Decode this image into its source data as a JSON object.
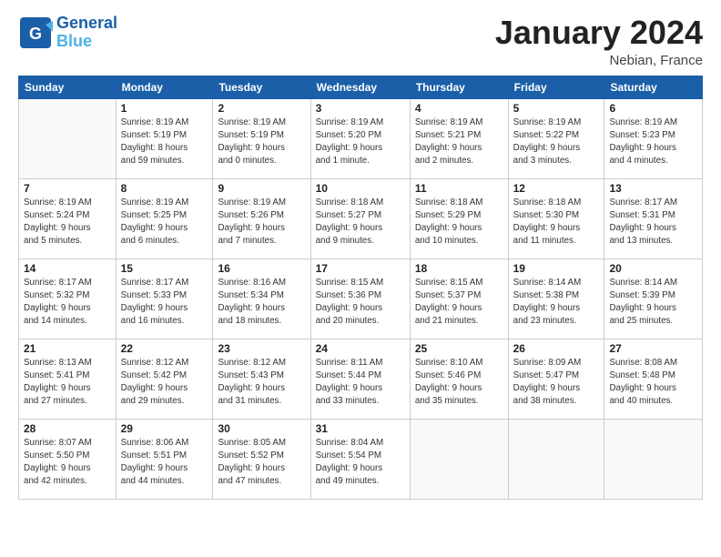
{
  "header": {
    "logo_line1": "General",
    "logo_line2": "Blue",
    "month_title": "January 2024",
    "location": "Nebian, France"
  },
  "weekdays": [
    "Sunday",
    "Monday",
    "Tuesday",
    "Wednesday",
    "Thursday",
    "Friday",
    "Saturday"
  ],
  "weeks": [
    [
      {
        "day": "",
        "sunrise": "",
        "sunset": "",
        "daylight": ""
      },
      {
        "day": "1",
        "sunrise": "Sunrise: 8:19 AM",
        "sunset": "Sunset: 5:19 PM",
        "daylight": "Daylight: 8 hours and 59 minutes."
      },
      {
        "day": "2",
        "sunrise": "Sunrise: 8:19 AM",
        "sunset": "Sunset: 5:19 PM",
        "daylight": "Daylight: 9 hours and 0 minutes."
      },
      {
        "day": "3",
        "sunrise": "Sunrise: 8:19 AM",
        "sunset": "Sunset: 5:20 PM",
        "daylight": "Daylight: 9 hours and 1 minute."
      },
      {
        "day": "4",
        "sunrise": "Sunrise: 8:19 AM",
        "sunset": "Sunset: 5:21 PM",
        "daylight": "Daylight: 9 hours and 2 minutes."
      },
      {
        "day": "5",
        "sunrise": "Sunrise: 8:19 AM",
        "sunset": "Sunset: 5:22 PM",
        "daylight": "Daylight: 9 hours and 3 minutes."
      },
      {
        "day": "6",
        "sunrise": "Sunrise: 8:19 AM",
        "sunset": "Sunset: 5:23 PM",
        "daylight": "Daylight: 9 hours and 4 minutes."
      }
    ],
    [
      {
        "day": "7",
        "sunrise": "Sunrise: 8:19 AM",
        "sunset": "Sunset: 5:24 PM",
        "daylight": "Daylight: 9 hours and 5 minutes."
      },
      {
        "day": "8",
        "sunrise": "Sunrise: 8:19 AM",
        "sunset": "Sunset: 5:25 PM",
        "daylight": "Daylight: 9 hours and 6 minutes."
      },
      {
        "day": "9",
        "sunrise": "Sunrise: 8:19 AM",
        "sunset": "Sunset: 5:26 PM",
        "daylight": "Daylight: 9 hours and 7 minutes."
      },
      {
        "day": "10",
        "sunrise": "Sunrise: 8:18 AM",
        "sunset": "Sunset: 5:27 PM",
        "daylight": "Daylight: 9 hours and 9 minutes."
      },
      {
        "day": "11",
        "sunrise": "Sunrise: 8:18 AM",
        "sunset": "Sunset: 5:29 PM",
        "daylight": "Daylight: 9 hours and 10 minutes."
      },
      {
        "day": "12",
        "sunrise": "Sunrise: 8:18 AM",
        "sunset": "Sunset: 5:30 PM",
        "daylight": "Daylight: 9 hours and 11 minutes."
      },
      {
        "day": "13",
        "sunrise": "Sunrise: 8:17 AM",
        "sunset": "Sunset: 5:31 PM",
        "daylight": "Daylight: 9 hours and 13 minutes."
      }
    ],
    [
      {
        "day": "14",
        "sunrise": "Sunrise: 8:17 AM",
        "sunset": "Sunset: 5:32 PM",
        "daylight": "Daylight: 9 hours and 14 minutes."
      },
      {
        "day": "15",
        "sunrise": "Sunrise: 8:17 AM",
        "sunset": "Sunset: 5:33 PM",
        "daylight": "Daylight: 9 hours and 16 minutes."
      },
      {
        "day": "16",
        "sunrise": "Sunrise: 8:16 AM",
        "sunset": "Sunset: 5:34 PM",
        "daylight": "Daylight: 9 hours and 18 minutes."
      },
      {
        "day": "17",
        "sunrise": "Sunrise: 8:15 AM",
        "sunset": "Sunset: 5:36 PM",
        "daylight": "Daylight: 9 hours and 20 minutes."
      },
      {
        "day": "18",
        "sunrise": "Sunrise: 8:15 AM",
        "sunset": "Sunset: 5:37 PM",
        "daylight": "Daylight: 9 hours and 21 minutes."
      },
      {
        "day": "19",
        "sunrise": "Sunrise: 8:14 AM",
        "sunset": "Sunset: 5:38 PM",
        "daylight": "Daylight: 9 hours and 23 minutes."
      },
      {
        "day": "20",
        "sunrise": "Sunrise: 8:14 AM",
        "sunset": "Sunset: 5:39 PM",
        "daylight": "Daylight: 9 hours and 25 minutes."
      }
    ],
    [
      {
        "day": "21",
        "sunrise": "Sunrise: 8:13 AM",
        "sunset": "Sunset: 5:41 PM",
        "daylight": "Daylight: 9 hours and 27 minutes."
      },
      {
        "day": "22",
        "sunrise": "Sunrise: 8:12 AM",
        "sunset": "Sunset: 5:42 PM",
        "daylight": "Daylight: 9 hours and 29 minutes."
      },
      {
        "day": "23",
        "sunrise": "Sunrise: 8:12 AM",
        "sunset": "Sunset: 5:43 PM",
        "daylight": "Daylight: 9 hours and 31 minutes."
      },
      {
        "day": "24",
        "sunrise": "Sunrise: 8:11 AM",
        "sunset": "Sunset: 5:44 PM",
        "daylight": "Daylight: 9 hours and 33 minutes."
      },
      {
        "day": "25",
        "sunrise": "Sunrise: 8:10 AM",
        "sunset": "Sunset: 5:46 PM",
        "daylight": "Daylight: 9 hours and 35 minutes."
      },
      {
        "day": "26",
        "sunrise": "Sunrise: 8:09 AM",
        "sunset": "Sunset: 5:47 PM",
        "daylight": "Daylight: 9 hours and 38 minutes."
      },
      {
        "day": "27",
        "sunrise": "Sunrise: 8:08 AM",
        "sunset": "Sunset: 5:48 PM",
        "daylight": "Daylight: 9 hours and 40 minutes."
      }
    ],
    [
      {
        "day": "28",
        "sunrise": "Sunrise: 8:07 AM",
        "sunset": "Sunset: 5:50 PM",
        "daylight": "Daylight: 9 hours and 42 minutes."
      },
      {
        "day": "29",
        "sunrise": "Sunrise: 8:06 AM",
        "sunset": "Sunset: 5:51 PM",
        "daylight": "Daylight: 9 hours and 44 minutes."
      },
      {
        "day": "30",
        "sunrise": "Sunrise: 8:05 AM",
        "sunset": "Sunset: 5:52 PM",
        "daylight": "Daylight: 9 hours and 47 minutes."
      },
      {
        "day": "31",
        "sunrise": "Sunrise: 8:04 AM",
        "sunset": "Sunset: 5:54 PM",
        "daylight": "Daylight: 9 hours and 49 minutes."
      },
      {
        "day": "",
        "sunrise": "",
        "sunset": "",
        "daylight": ""
      },
      {
        "day": "",
        "sunrise": "",
        "sunset": "",
        "daylight": ""
      },
      {
        "day": "",
        "sunrise": "",
        "sunset": "",
        "daylight": ""
      }
    ]
  ]
}
